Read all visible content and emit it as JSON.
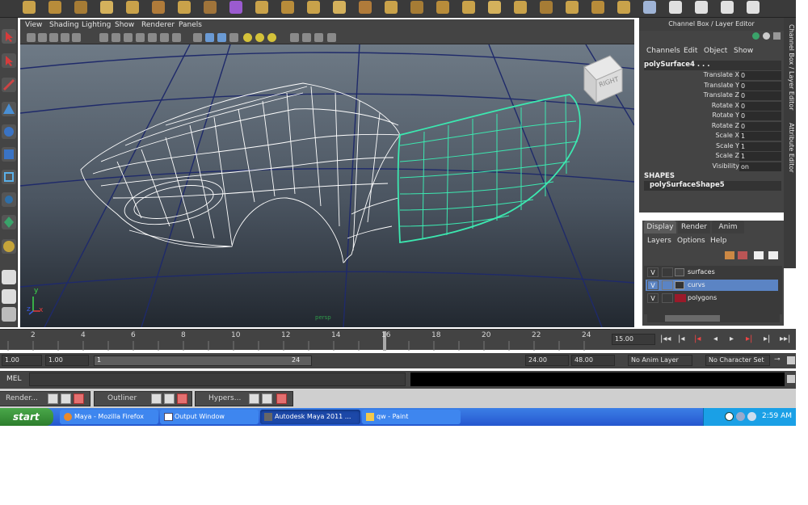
{
  "viewport": {
    "menu": [
      "View",
      "Shading",
      "Lighting",
      "Show",
      "Renderer",
      "Panels"
    ],
    "view_cube_label": "RIGHT",
    "camera_label": "persp",
    "axis": {
      "y": "y",
      "x": "x",
      "z": "z"
    }
  },
  "channel_box": {
    "title": "Channel Box / Layer Editor",
    "menu": [
      "Channels",
      "Edit",
      "Object",
      "Show"
    ],
    "object_name": "polySurface4 . . .",
    "attributes": [
      {
        "label": "Translate X",
        "value": "0"
      },
      {
        "label": "Translate Y",
        "value": "0"
      },
      {
        "label": "Translate Z",
        "value": "0"
      },
      {
        "label": "Rotate X",
        "value": "0"
      },
      {
        "label": "Rotate Y",
        "value": "0"
      },
      {
        "label": "Rotate Z",
        "value": "0"
      },
      {
        "label": "Scale X",
        "value": "1"
      },
      {
        "label": "Scale Y",
        "value": "1"
      },
      {
        "label": "Scale Z",
        "value": "1"
      },
      {
        "label": "Visibility",
        "value": "on"
      }
    ],
    "shapes_header": "SHAPES",
    "shape_name": "polySurfaceShape5",
    "side_tabs": [
      "Channel Box / Layer Editor",
      "Attribute Editor"
    ]
  },
  "layer_editor": {
    "tabs": [
      "Display",
      "Render",
      "Anim"
    ],
    "menu": [
      "Layers",
      "Options",
      "Help"
    ],
    "layers": [
      {
        "visible": "V",
        "name": "surfaces",
        "color": "#444444"
      },
      {
        "visible": "V",
        "name": "curvs",
        "color": "#333333"
      },
      {
        "visible": "V",
        "name": "polygons",
        "color": "#9a1a2a"
      }
    ]
  },
  "time_slider": {
    "ticks": [
      "2",
      "4",
      "6",
      "8",
      "10",
      "12",
      "14",
      "16",
      "18",
      "20",
      "22",
      "24"
    ],
    "current_frame": "15.00"
  },
  "range_slider": {
    "start": "1.00",
    "playback_start": "1.00",
    "range_start": "1",
    "range_end": "24",
    "playback_end": "24.00",
    "end": "48.00",
    "anim_layer": "No Anim Layer",
    "character_set": "No Character Set"
  },
  "command_line": {
    "label": "MEL"
  },
  "minimized_windows": [
    "Render...",
    "Outliner",
    "Hypers..."
  ],
  "taskbar": {
    "start_label": "start",
    "tasks": [
      "Maya - Mozilla Firefox",
      "Output Window",
      "Autodesk Maya 2011 ...",
      "qw - Paint"
    ],
    "language": "EN",
    "clock": "2:59 AM"
  }
}
